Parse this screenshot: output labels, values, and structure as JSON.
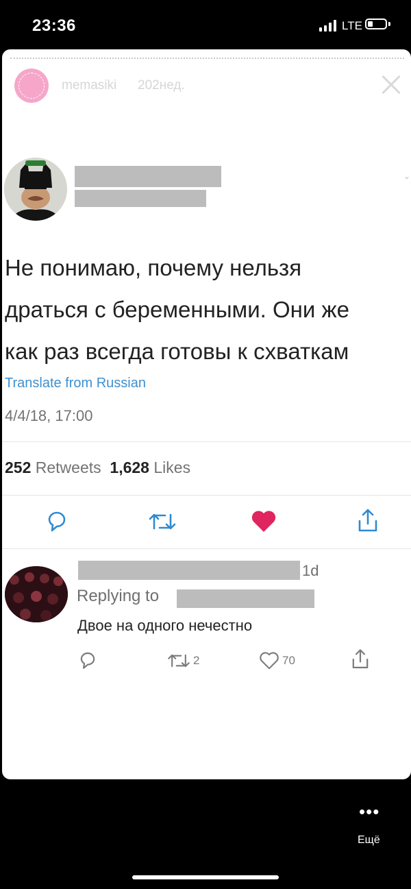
{
  "status_bar": {
    "time": "23:36",
    "network": "LTE",
    "battery_level": 0.3
  },
  "story": {
    "username": "memasiki",
    "time_ago": "202нед.",
    "avatar_icon": "profile-avatar-icon",
    "close_icon": "close-icon"
  },
  "tweet": {
    "author_avatar_icon": "batman-avatar-icon",
    "text_lines": [
      "Не понимаю, почему нельзя",
      "драться с беременными. Они же",
      "как раз всегда готовы к схваткам"
    ],
    "translate_label": "Translate from Russian",
    "date": "4/4/18, 17:00",
    "retweets_count": "252",
    "retweets_label": "Retweets",
    "likes_count": "1,628",
    "likes_label": "Likes",
    "like_color": "#e0245e",
    "actions": [
      "reply-icon",
      "retweet-icon",
      "like-icon",
      "share-icon"
    ]
  },
  "reply": {
    "time_ago": "1d",
    "replying_to_label": "Replying to",
    "text": "Двое на одного нечестно",
    "retweets": "2",
    "likes": "70"
  },
  "bottom_bar": {
    "more_dots": "•••",
    "more_label": "Ещё"
  }
}
